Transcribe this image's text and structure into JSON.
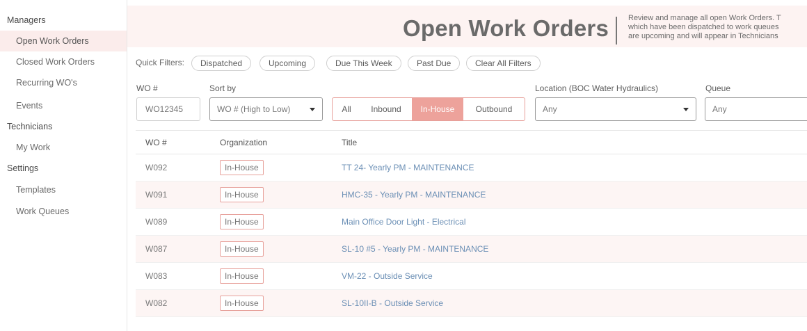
{
  "sidebar": {
    "sections": [
      {
        "heading": "Managers",
        "items": [
          "Open Work Orders",
          "Closed Work Orders",
          "Recurring WO's",
          "Events"
        ]
      },
      {
        "heading": "Technicians",
        "items": [
          "My Work"
        ]
      },
      {
        "heading": "Settings",
        "items": [
          "Templates",
          "Work Queues"
        ]
      }
    ],
    "active_item": "Open Work Orders"
  },
  "header": {
    "title": "Open Work Orders",
    "description_lines": [
      "Review and manage all open Work Orders. T",
      "which have been dispatched to work queues",
      "are upcoming and will appear in Technicians"
    ]
  },
  "quick_filters": {
    "label": "Quick Filters:",
    "pills": [
      "Dispatched",
      "Upcoming",
      "Due This Week",
      "Past Due",
      "Clear All Filters"
    ]
  },
  "filters": {
    "wo_label": "WO #",
    "wo_placeholder": "WO12345",
    "sort_label": "Sort by",
    "sort_value": "WO # (High to Low)",
    "segments": [
      "All",
      "Inbound",
      "In-House",
      "Outbound"
    ],
    "active_segment": "In-House",
    "location_label": "Location (BOC Water Hydraulics)",
    "location_value": "Any",
    "queue_label": "Queue",
    "queue_value": "Any"
  },
  "table": {
    "columns": [
      "WO #",
      "Organization",
      "Title"
    ],
    "rows": [
      {
        "wo": "W092",
        "org": "In-House",
        "title": "TT 24- Yearly PM - MAINTENANCE"
      },
      {
        "wo": "W091",
        "org": "In-House",
        "title": "HMC-35 - Yearly PM - MAINTENANCE"
      },
      {
        "wo": "W089",
        "org": "In-House",
        "title": "Main Office Door Light - Electrical"
      },
      {
        "wo": "W087",
        "org": "In-House",
        "title": "SL-10 #5 - Yearly PM - MAINTENANCE"
      },
      {
        "wo": "W083",
        "org": "In-House",
        "title": "VM-22 - Outside Service"
      },
      {
        "wo": "W082",
        "org": "In-House",
        "title": "SL-10II-B - Outside Service"
      }
    ]
  },
  "colors": {
    "accent": "#eda29b",
    "accent_light": "#fbeceb",
    "link": "#6b8fb5"
  }
}
